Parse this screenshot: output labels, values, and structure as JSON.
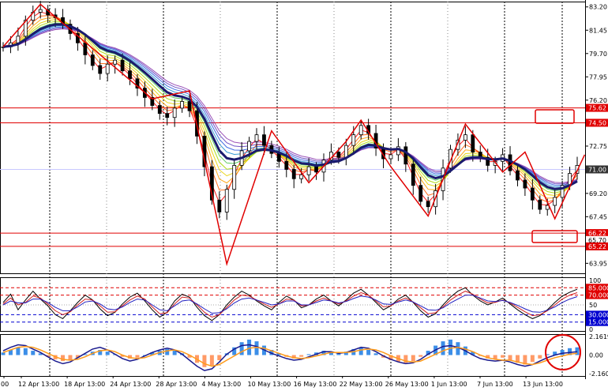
{
  "chart_data": [
    {
      "type": "candlestick",
      "panel": "price",
      "x_labels": [
        "12 Apr 13:00",
        "18 Apr 13:00",
        "24 Apr 13:00",
        "28 Apr 13:00",
        "4 May 13:00",
        "10 May 13:00",
        "16 May 13:00",
        "22 May 13:00",
        "26 May 13:00",
        "1 Jun 13:00",
        "7 Jun 13:00",
        "13 Jun 13:00"
      ],
      "first_x_label_fragment": "00",
      "y_ticks": [
        "83.20",
        "81.45",
        "79.70",
        "77.95",
        "76.20",
        "74.50",
        "72.75",
        "71.00",
        "69.20",
        "67.45",
        "65.70",
        "63.95"
      ],
      "ylim": [
        63.2,
        83.6
      ],
      "closes": [
        80.2,
        80.5,
        81.0,
        82.2,
        82.8,
        83.0,
        82.6,
        82.4,
        81.9,
        81.2,
        80.5,
        79.6,
        78.8,
        78.2,
        78.9,
        79.2,
        78.4,
        77.8,
        77.1,
        76.4,
        75.8,
        75.2,
        74.9,
        75.6,
        76.1,
        75.4,
        73.5,
        71.2,
        68.7,
        67.8,
        69.5,
        71.3,
        72.4,
        73.1,
        73.6,
        72.8,
        72.2,
        71.6,
        71.0,
        70.3,
        70.6,
        71.2,
        70.8,
        71.7,
        72.3,
        71.9,
        72.8,
        73.6,
        74.3,
        73.7,
        72.6,
        71.8,
        72.1,
        72.7,
        71.4,
        69.8,
        68.6,
        68.2,
        69.4,
        71.1,
        72.5,
        73.2,
        73.6,
        72.3,
        71.9,
        71.3,
        71.6,
        72.1,
        70.9,
        70.2,
        69.6,
        68.7,
        68.0,
        68.3,
        68.9,
        69.8,
        70.7,
        71.3
      ],
      "horizontal_levels": [
        {
          "label": "75.62",
          "value": 75.62,
          "color": "#e00000"
        },
        {
          "label": "74.50",
          "value": 74.5,
          "color": "#e00000"
        },
        {
          "label": "71.00",
          "value": 71.0,
          "color": "#333333"
        },
        {
          "label": "66.22",
          "value": 66.22,
          "color": "#e00000"
        },
        {
          "label": "65.70",
          "value": 65.7,
          "color": "#ffffff"
        },
        {
          "label": "65.22",
          "value": 65.22,
          "color": "#e00000"
        }
      ],
      "series": [
        {
          "color": "#1a1a6e"
        },
        {
          "color": "#e00000"
        }
      ]
    },
    {
      "type": "line",
      "panel": "oscillator",
      "y_ticks": [
        "100",
        "85.000",
        "70.000",
        "50",
        "30.000",
        "15.000",
        "0"
      ],
      "ylim": [
        0,
        100
      ],
      "levels": [
        {
          "label": "85.000",
          "value": 85,
          "color": "#e00000"
        },
        {
          "label": "70.000",
          "value": 70,
          "color": "#e00000"
        },
        {
          "label": "30.000",
          "value": 30,
          "color": "#0000d0"
        },
        {
          "label": "15.000",
          "value": 15,
          "color": "#0000d0"
        }
      ],
      "series": [
        {
          "color": "#000000",
          "values": [
            55,
            72,
            40,
            60,
            78,
            62,
            48,
            30,
            22,
            38,
            55,
            70,
            60,
            42,
            28,
            35,
            52,
            66,
            74,
            58,
            40,
            25,
            35,
            58,
            72,
            66,
            45,
            28,
            18,
            30,
            50,
            66,
            78,
            70,
            58,
            48,
            40,
            55,
            68,
            60,
            44,
            50,
            62,
            70,
            58,
            48,
            60,
            74,
            82,
            70,
            55,
            40,
            48,
            62,
            70,
            55,
            38,
            25,
            32,
            50,
            66,
            78,
            85,
            70,
            58,
            50,
            56,
            64,
            52,
            40,
            30,
            22,
            28,
            40,
            55,
            68,
            76,
            82
          ]
        },
        {
          "color": "#d02020",
          "values": [
            52,
            64,
            50,
            55,
            68,
            64,
            52,
            38,
            30,
            36,
            50,
            62,
            60,
            48,
            35,
            36,
            48,
            60,
            68,
            62,
            46,
            32,
            34,
            52,
            66,
            64,
            50,
            35,
            25,
            30,
            45,
            60,
            70,
            68,
            60,
            52,
            45,
            52,
            62,
            60,
            48,
            50,
            58,
            64,
            58,
            52,
            58,
            68,
            75,
            70,
            58,
            46,
            48,
            58,
            64,
            56,
            44,
            32,
            34,
            46,
            60,
            70,
            78,
            72,
            62,
            54,
            55,
            60,
            54,
            45,
            36,
            28,
            30,
            38,
            50,
            62,
            70,
            75
          ]
        },
        {
          "color": "#2020c0",
          "values": [
            50,
            58,
            54,
            54,
            62,
            62,
            55,
            45,
            38,
            38,
            46,
            56,
            58,
            52,
            42,
            40,
            46,
            55,
            62,
            60,
            50,
            40,
            38,
            48,
            58,
            60,
            52,
            42,
            33,
            34,
            42,
            54,
            62,
            64,
            60,
            55,
            50,
            52,
            58,
            58,
            50,
            50,
            55,
            60,
            58,
            54,
            57,
            63,
            68,
            66,
            60,
            52,
            51,
            56,
            60,
            56,
            48,
            40,
            39,
            44,
            54,
            62,
            70,
            70,
            64,
            58,
            57,
            59,
            55,
            49,
            42,
            36,
            35,
            39,
            46,
            55,
            62,
            67
          ]
        }
      ]
    },
    {
      "type": "bar",
      "panel": "macd",
      "y_ticks": [
        "2.1619",
        "0.00",
        "-2.1606"
      ],
      "ylim": [
        -2.1606,
        2.1619
      ],
      "values": [
        0.3,
        0.6,
        0.9,
        0.8,
        0.5,
        0.2,
        -0.2,
        -0.5,
        -0.7,
        -0.6,
        -0.3,
        0.1,
        0.4,
        0.6,
        0.4,
        0.1,
        -0.2,
        -0.4,
        -0.3,
        0.0,
        0.3,
        0.5,
        0.7,
        0.5,
        0.2,
        -0.3,
        -0.9,
        -1.4,
        -1.2,
        -0.6,
        0.2,
        0.9,
        1.5,
        1.8,
        1.6,
        1.1,
        0.6,
        0.2,
        -0.2,
        -0.4,
        -0.2,
        0.1,
        0.3,
        0.5,
        0.4,
        0.2,
        0.4,
        0.7,
        0.9,
        0.6,
        0.2,
        -0.3,
        -0.6,
        -0.8,
        -0.9,
        -0.7,
        -0.2,
        0.5,
        1.1,
        1.6,
        1.8,
        1.5,
        1.0,
        0.4,
        -0.1,
        -0.4,
        -0.5,
        -0.3,
        -0.6,
        -0.9,
        -1.1,
        -0.8,
        -0.4,
        0.1,
        0.4,
        0.6,
        0.8,
        0.9
      ],
      "series": [
        {
          "color": "#1a1a8e",
          "values": [
            0.5,
            0.9,
            1.2,
            1.1,
            0.7,
            0.3,
            -0.2,
            -0.7,
            -1.0,
            -0.8,
            -0.3,
            0.2,
            0.7,
            0.9,
            0.6,
            0.1,
            -0.4,
            -0.7,
            -0.5,
            -0.1,
            0.3,
            0.6,
            0.8,
            0.6,
            0.1,
            -0.6,
            -1.3,
            -1.8,
            -1.6,
            -0.8,
            0.1,
            0.7,
            1.1,
            1.2,
            1.0,
            0.6,
            0.2,
            -0.1,
            -0.4,
            -0.6,
            -0.5,
            -0.2,
            0.1,
            0.4,
            0.4,
            0.2,
            0.3,
            0.6,
            0.9,
            0.8,
            0.4,
            -0.1,
            -0.5,
            -0.8,
            -1.0,
            -0.9,
            -0.5,
            0.1,
            0.6,
            1.0,
            1.1,
            0.9,
            0.5,
            0.0,
            -0.4,
            -0.6,
            -0.7,
            -0.6,
            -0.8,
            -1.1,
            -1.3,
            -1.1,
            -0.7,
            -0.3,
            0.0,
            0.2,
            0.3,
            0.4
          ]
        },
        {
          "color": "#ff9a1a",
          "values": [
            0.3,
            0.6,
            0.9,
            1.0,
            0.9,
            0.6,
            0.2,
            -0.2,
            -0.5,
            -0.6,
            -0.5,
            -0.2,
            0.2,
            0.5,
            0.6,
            0.4,
            0.0,
            -0.3,
            -0.4,
            -0.3,
            0.0,
            0.3,
            0.5,
            0.6,
            0.4,
            0.0,
            -0.5,
            -1.0,
            -1.3,
            -1.1,
            -0.6,
            -0.1,
            0.4,
            0.8,
            0.9,
            0.8,
            0.5,
            0.2,
            -0.1,
            -0.3,
            -0.4,
            -0.3,
            -0.1,
            0.1,
            0.3,
            0.3,
            0.3,
            0.4,
            0.6,
            0.7,
            0.6,
            0.3,
            -0.1,
            -0.4,
            -0.7,
            -0.8,
            -0.7,
            -0.3,
            0.1,
            0.5,
            0.8,
            0.9,
            0.7,
            0.4,
            0.0,
            -0.3,
            -0.5,
            -0.6,
            -0.6,
            -0.8,
            -1.0,
            -1.1,
            -0.9,
            -0.6,
            -0.3,
            -0.1,
            0.1,
            0.2
          ]
        }
      ]
    }
  ]
}
